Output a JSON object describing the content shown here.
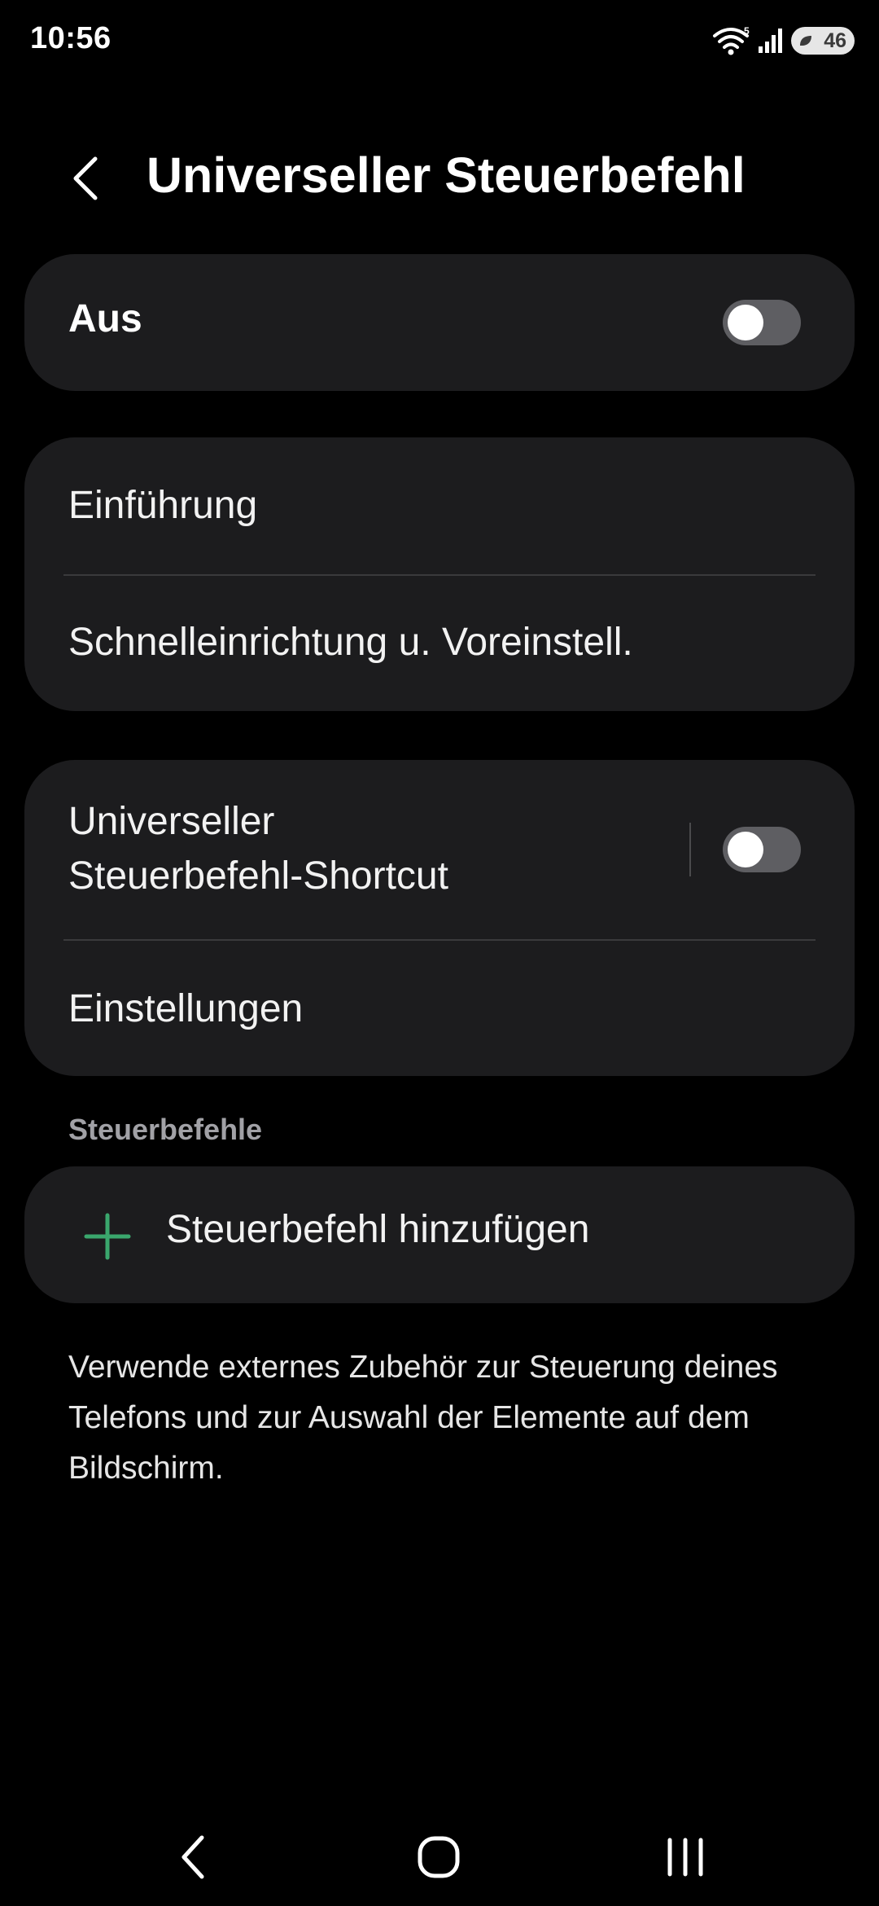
{
  "status_bar": {
    "time": "10:56",
    "battery_level": "46",
    "icons": [
      "wifi-icon",
      "signal-icon",
      "battery-icon"
    ]
  },
  "header": {
    "back_icon": "chevron-left-icon",
    "title": "Universeller Steuerbefehl"
  },
  "master_switch": {
    "label": "Aus",
    "enabled": false
  },
  "group1": {
    "items": [
      {
        "label": "Einführung"
      },
      {
        "label": "Schnelleinrichtung u. Voreinstell."
      }
    ]
  },
  "group2": {
    "shortcut": {
      "label_line1": "Universeller",
      "label_line2": "Steuerbefehl-Shortcut",
      "enabled": false
    },
    "settings_label": "Einstellungen"
  },
  "section": {
    "title": "Steuerbefehle",
    "add_label": "Steuerbefehl hinzufügen",
    "add_icon": "plus-icon",
    "accent_color": "#3aa76d"
  },
  "description": "Verwende externes Zubehör zur Steuerung deines Telefons und zur Auswahl der Elemente auf dem Bildschirm.",
  "nav_bar": {
    "icons": [
      "back-icon",
      "home-icon",
      "recents-icon"
    ]
  }
}
